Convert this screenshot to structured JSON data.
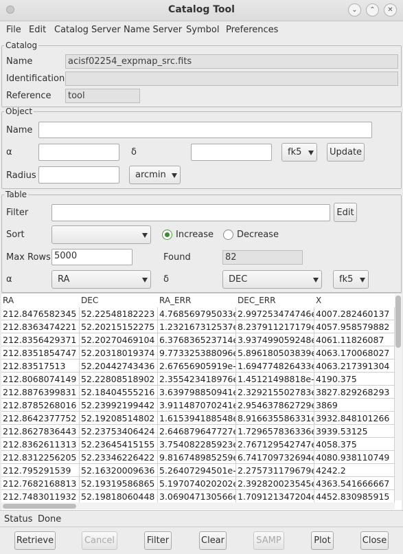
{
  "window": {
    "title": "Catalog Tool"
  },
  "menu": [
    "File",
    "Edit",
    "Catalog Server",
    "Name Server",
    "Symbol",
    "Preferences"
  ],
  "catalog": {
    "legend": "Catalog",
    "name_label": "Name",
    "name_value": "acisf02254_expmap_src.fits",
    "identification_label": "Identification",
    "identification_value": "",
    "reference_label": "Reference",
    "reference_value": "tool"
  },
  "object": {
    "legend": "Object",
    "name_label": "Name",
    "name_value": "",
    "alpha_label": "α",
    "alpha_value": "",
    "delta_label": "δ",
    "delta_value": "",
    "frame": "fk5",
    "update_label": "Update",
    "radius_label": "Radius",
    "radius_value": "",
    "radius_unit": "arcmin"
  },
  "table": {
    "legend": "Table",
    "filter_label": "Filter",
    "filter_value": "",
    "edit_label": "Edit",
    "sort_label": "Sort",
    "sort_value": "",
    "increase_label": "Increase",
    "decrease_label": "Decrease",
    "increase_selected": true,
    "maxrows_label": "Max Rows",
    "maxrows_value": "5000",
    "found_label": "Found",
    "found_value": "82",
    "alpha_label": "α",
    "alpha_col": "RA",
    "delta_label": "δ",
    "delta_col": "DEC",
    "frame": "fk5",
    "columns": [
      "RA",
      "DEC",
      "RA_ERR",
      "DEC_ERR",
      "X"
    ],
    "rows": [
      [
        "212.8476582345",
        "52.22548182223",
        "4.768569795033e",
        "2.997253474746e",
        "4007.282460137"
      ],
      [
        "212.8363474221",
        "52.20215152275",
        "1.232167312537e",
        "8.237911217179e",
        "4057.958579882"
      ],
      [
        "212.8356429371",
        "52.20270469104",
        "6.376836523714e",
        "3.937499059248e",
        "4061.11826087"
      ],
      [
        "212.8351854747",
        "52.20318019374",
        "9.773325388096e",
        "5.896180503839e",
        "4063.170068027"
      ],
      [
        "212.83517513",
        "52.20442743436",
        "2.67656905919e-",
        "1.694774826433e",
        "4063.217391304"
      ],
      [
        "212.8068074149",
        "52.22808518902",
        "2.355423418976e",
        "1.45121498818e-",
        "4190.375"
      ],
      [
        "212.8876399831",
        "52.18404555216",
        "3.639798850941e",
        "2.329215502783e",
        "3827.829268293"
      ],
      [
        "212.8785268016",
        "52.23992199442",
        "3.911487070241e",
        "2.954637862729e",
        "3869"
      ],
      [
        "212.8642377752",
        "52.19208514802",
        "1.615394188548e",
        "8.916635586331e",
        "3932.848101266"
      ],
      [
        "212.8627836443",
        "52.23753406424",
        "2.646879647727e",
        "1.729657836336e",
        "3939.53125"
      ],
      [
        "212.8362611313",
        "52.23645415155",
        "3.754082285923e",
        "2.767129542747e",
        "4058.375"
      ],
      [
        "212.8312256205",
        "52.23346226422",
        "9.816748985259e",
        "6.741709732694e",
        "4080.938110749"
      ],
      [
        "212.795291539",
        "52.16320009636",
        "5.26407294501e-",
        "2.275731179679e",
        "4242.2"
      ],
      [
        "212.7682168813",
        "52.19319586865",
        "5.197074020202e",
        "2.392820023545e",
        "4363.541666667"
      ],
      [
        "212.7483011932",
        "52.19818060448",
        "3.069047130566e",
        "1.709121347204e",
        "4452.830985915"
      ]
    ]
  },
  "status": {
    "label": "Status",
    "value": "Done"
  },
  "buttons": {
    "retrieve": "Retrieve",
    "cancel": "Cancel",
    "filter": "Filter",
    "clear": "Clear",
    "samp": "SAMP",
    "plot": "Plot",
    "close": "Close"
  }
}
